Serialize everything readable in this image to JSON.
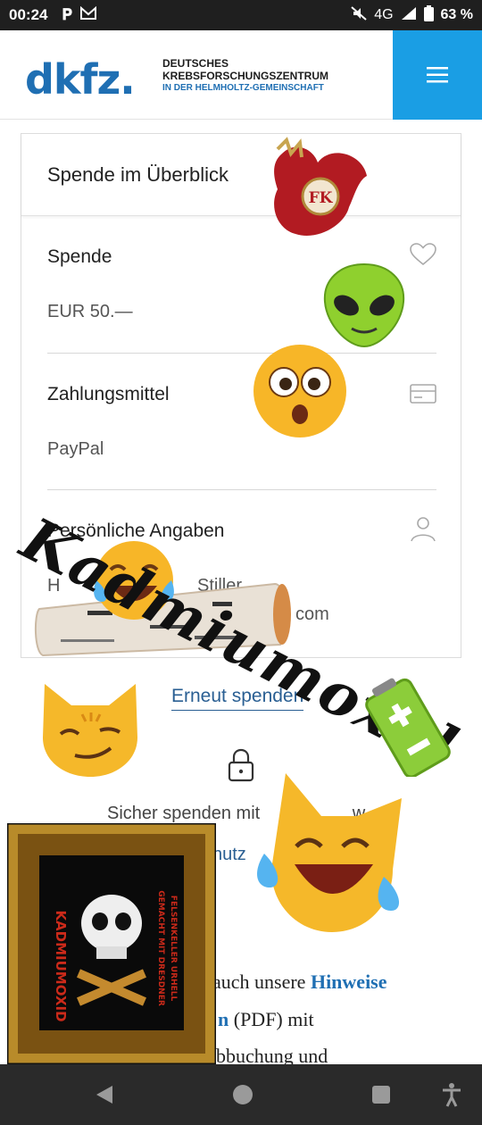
{
  "status_bar": {
    "time": "00:24",
    "network": "4G",
    "battery": "63 %"
  },
  "header": {
    "logo_mark": "dkfz.",
    "logo_line1": "DEUTSCHES",
    "logo_line2": "KREBSFORSCHUNGSZENTRUM",
    "logo_line3": "IN DER HELMHOLTZ-GEMEINSCHAFT"
  },
  "card": {
    "title": "Spende im Überblick",
    "donation": {
      "label": "Spende",
      "value": "EUR 50.—"
    },
    "payment": {
      "label": "Zahlungsmittel",
      "value": "PayPal"
    },
    "personal": {
      "label": "Persönliche Angaben",
      "name_fragment": "H",
      "name_fragment2": "Stiller",
      "email_fragment": "com"
    }
  },
  "actions": {
    "donate_again": "Erneut spenden"
  },
  "secure": {
    "text": "Sicher spenden mit",
    "text_end": "w",
    "privacy_link": "hutz"
  },
  "paragraph": {
    "line1_start": "auch unsere ",
    "line1_bold": "Hinweise",
    "line2_bold": "n",
    "line2_rest": " (PDF) mit",
    "line3": "bbuchung und"
  },
  "overlay": {
    "watermark": "Kadmiumoxid",
    "frame_title": "KADMIUMOXID",
    "frame_sub1": "GEMACHT MIT DRESDNER",
    "frame_sub2": "FELSENKELLER URHELL",
    "badge": "FK"
  },
  "colors": {
    "brand_blue": "#1f6fb3",
    "menu_blue": "#1a9ee4",
    "link_blue": "#2a5f93"
  }
}
